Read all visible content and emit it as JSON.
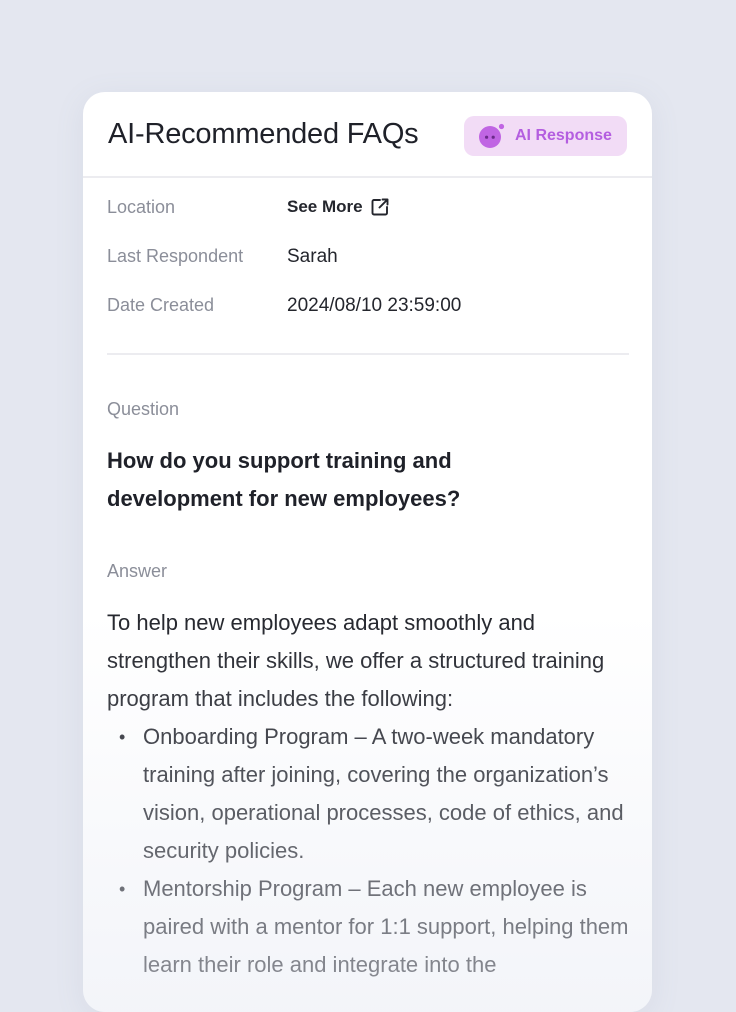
{
  "card": {
    "title": "AI-Recommended FAQs",
    "badge_label": "AI Response",
    "badge_icon": "ai-bot-icon",
    "colors": {
      "badge_bg": "#f2dcf6",
      "badge_text": "#b45ee0",
      "label_gray": "#8b8e99"
    }
  },
  "meta": {
    "location_label": "Location",
    "location_value": "See More",
    "location_icon": "external-link-icon",
    "respondent_label": "Last Respondent",
    "respondent_value": "Sarah",
    "date_label": "Date Created",
    "date_value": "2024/08/10 23:59:00"
  },
  "question": {
    "label": "Question",
    "text": "How do you support training and development for new employees?"
  },
  "answer": {
    "label": "Answer",
    "intro": "To help new employees adapt smoothly and strengthen their skills, we offer a structured training program that includes the following:",
    "items": [
      "Onboarding Program – A two-week mandatory training after joining, covering the organization’s vision, operational processes, code of ethics, and security policies.",
      "Mentorship Program – Each new employee is paired with a mentor for 1:1 support, helping them learn their role and integrate into the"
    ]
  }
}
